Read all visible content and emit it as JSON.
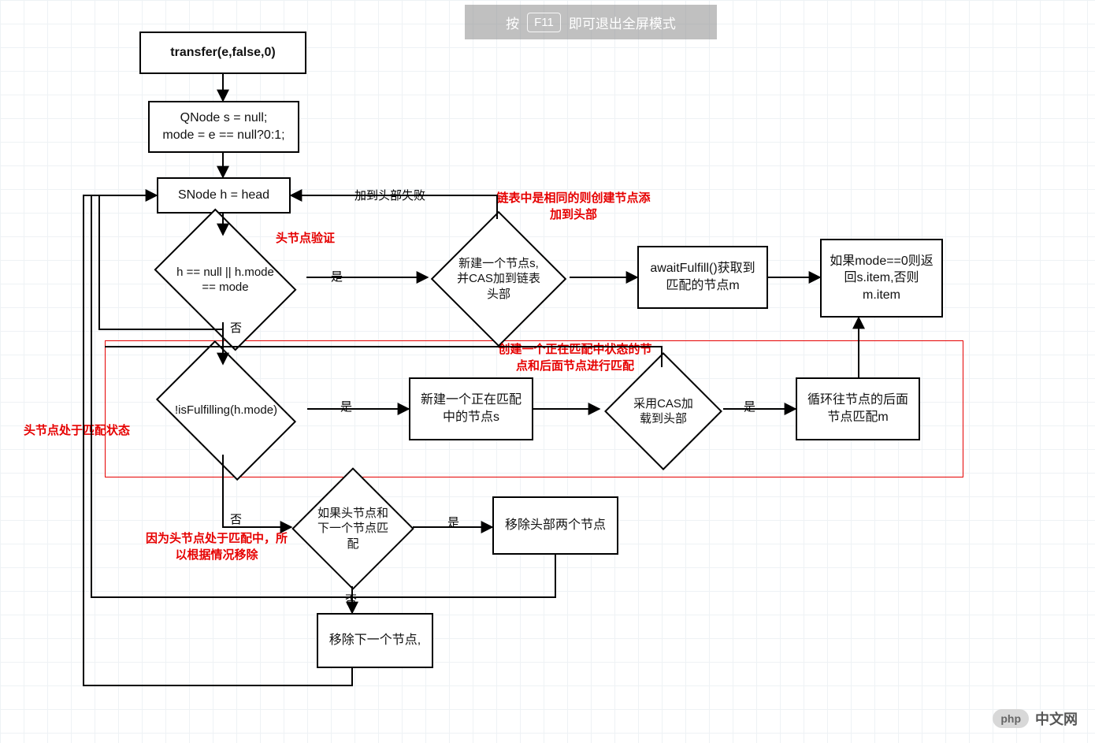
{
  "overlay": {
    "prefix": "按",
    "key": "F11",
    "suffix": "即可退出全屏模式"
  },
  "watermark": {
    "badge": "php",
    "text": "中文网"
  },
  "nodes": {
    "start": "transfer(e,false,0)",
    "init": "QNode s = null;\nmode = e == null?0:1;",
    "loop": "SNode h = head",
    "cond1": "h == null || h.mode == mode",
    "newNode": "新建一个节点s,并CAS加到链表头部",
    "await": "awaitFulfill()获取到匹配的节点m",
    "result": "如果mode==0则返回s.item,否则m.item",
    "cond2": "!isFulfilling(h.mode)",
    "newInMatch": "新建一个正在匹配中的节点s",
    "casHead": "采用CAS加载到头部",
    "loopMatch": "循环往节点的后面节点匹配m",
    "cond3": "如果头节点和下一个节点匹配",
    "removeTwo": "移除头部两个节点",
    "removeNext": "移除下一个节点,"
  },
  "labels": {
    "addHeadFail": "加到头部失败",
    "yes1": "是",
    "no1": "否",
    "yes2": "是",
    "no2": "否",
    "yes3": "是",
    "no3": "否",
    "yes4": "是"
  },
  "annotations": {
    "a1": "链表中是相同的则创建节点添加到头部",
    "a2": "头节点验证",
    "a3": "创建一个正在匹配中状态的节点和后面节点进行匹配",
    "a4": "头节点处于匹配状态",
    "a5": "因为头节点处于匹配中，所以根据情况移除"
  }
}
